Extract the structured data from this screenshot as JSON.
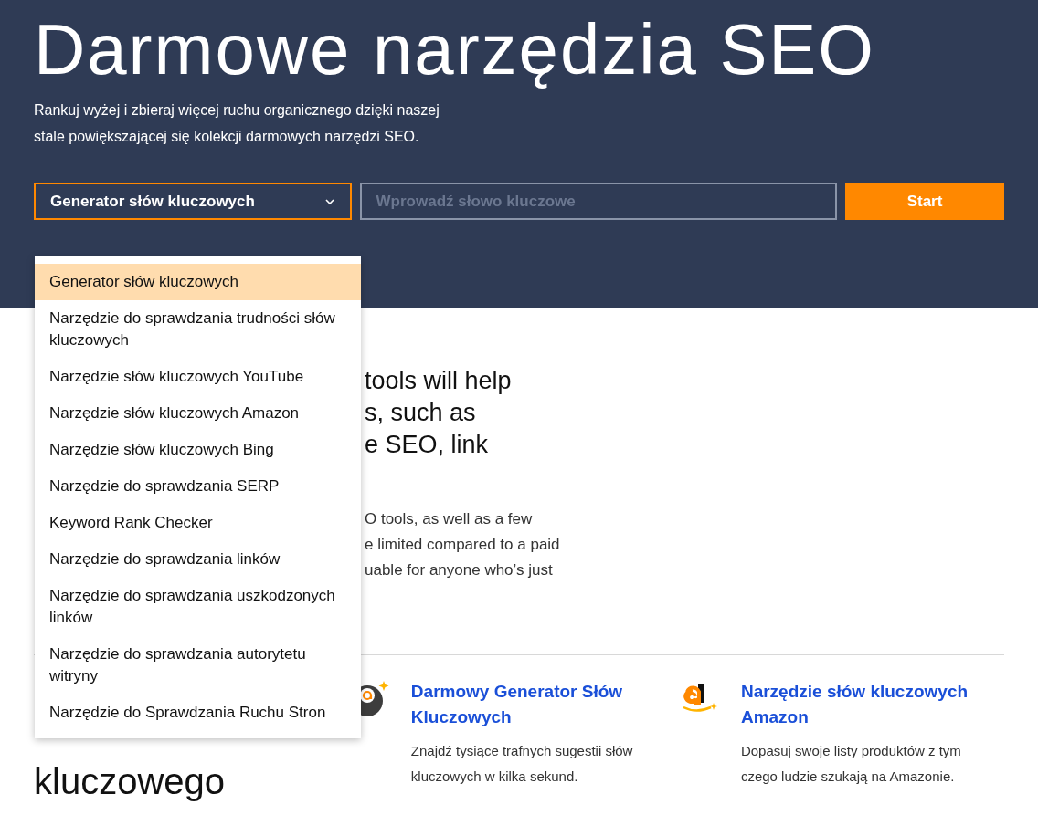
{
  "header": {
    "title": "Darmowe narzędzia SEO",
    "subtitle": "Rankuj wyżej i zbieraj więcej ruchu organicznego dzięki naszej stale powiększającej się kolekcji darmowych narzędzi SEO."
  },
  "search": {
    "tool_select": {
      "value": "Generator słów kluczowych",
      "expanded": true
    },
    "keyword_field": {
      "placeholder": "Wprowadź słowo kluczowe"
    },
    "button": "Start"
  },
  "dropdown_options": [
    {
      "label": "Generator słów kluczowych",
      "selected": true
    },
    {
      "label": "Narzędzie do sprawdzania trudności słów kluczowych",
      "selected": false
    },
    {
      "label": "Narzędzie słów kluczowych YouTube",
      "selected": false
    },
    {
      "label": "Narzędzie słów kluczowych Amazon",
      "selected": false
    },
    {
      "label": "Narzędzie słów kluczowych Bing",
      "selected": false
    },
    {
      "label": "Narzędzie do sprawdzania SERP",
      "selected": false
    },
    {
      "label": "Keyword Rank Checker",
      "selected": false
    },
    {
      "label": "Narzędzie do sprawdzania linków",
      "selected": false
    },
    {
      "label": "Narzędzie do sprawdzania uszkodzonych linków",
      "selected": false
    },
    {
      "label": "Narzędzie do sprawdzania autorytetu witryny",
      "selected": false
    },
    {
      "label": "Narzędzie do Sprawdzania Ruchu Stron",
      "selected": false
    }
  ],
  "intro": {
    "heading_lines": [
      "tools will help",
      "s, such as",
      "e SEO, link"
    ],
    "paragraph_lines": [
      "O tools, as well as a few",
      "e limited compared to a paid",
      "uable for anyone who’s just"
    ]
  },
  "section_heading": "kluczowego",
  "tool_cards": [
    {
      "kind": "ball",
      "title": "Darmowy Generator Słów Kluczowych",
      "description": "Znajdź tysiące trafnych sugestii słów kluczowych w kilka sekund."
    },
    {
      "kind": "amazon",
      "title": "Narzędzie słów kluczowych Amazon",
      "description": "Dopasuj swoje listy produktów z tym czego ludzie szukają na Amazonie."
    }
  ]
}
